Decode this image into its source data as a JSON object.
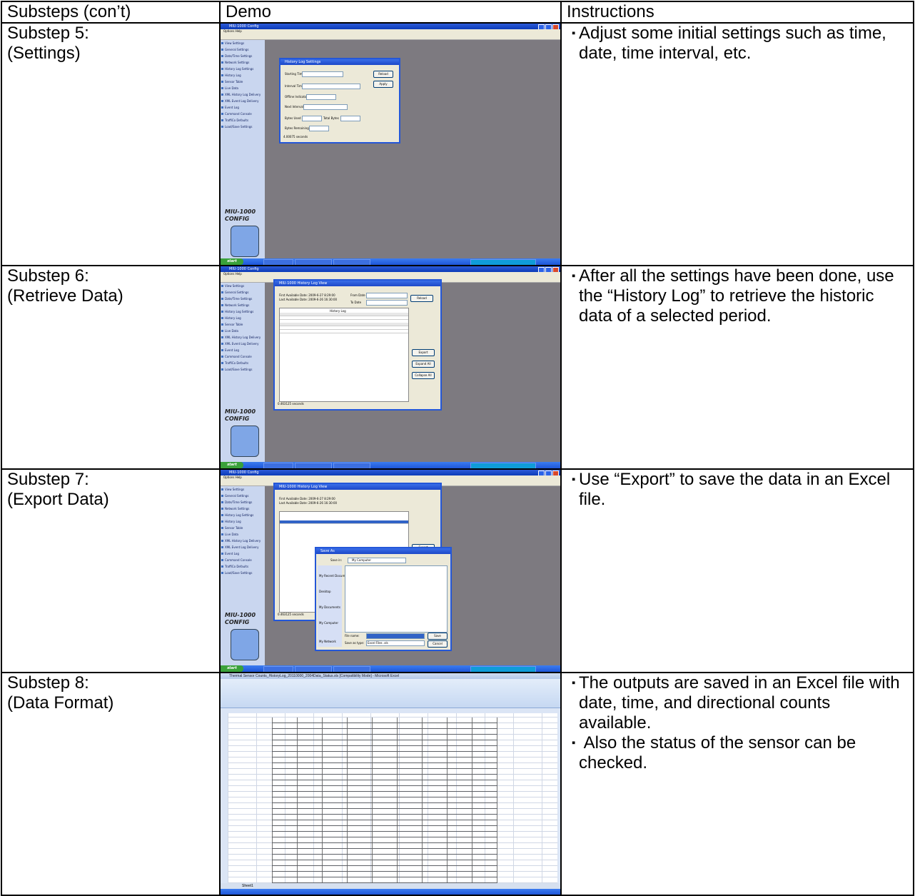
{
  "headers": {
    "substeps": "Substeps (con’t)",
    "demo": "Demo",
    "instructions": "Instructions"
  },
  "rows": [
    {
      "substep": "Substep 5:",
      "subtitle": "(Settings)",
      "instructions": [
        "Adjust some initial settings such as time, date, time interval, etc."
      ]
    },
    {
      "substep": "Substep 6:",
      "subtitle": "(Retrieve Data)",
      "instructions": [
        "After all the settings have been done, use the “History Log” to retrieve the historic data of a selected period."
      ]
    },
    {
      "substep": "Substep 7:",
      "subtitle": "(Export Data)",
      "instructions": [
        "Use “Export” to save the data in an Excel file."
      ]
    },
    {
      "substep": "Substep 8:",
      "subtitle": "(Data Format)",
      "instructions": [
        "The outputs are saved in an Excel file with date, time, and directional counts available.",
        " Also the status of the sensor can be checked."
      ]
    }
  ],
  "bullet_glyph": "▪",
  "miu_app": {
    "title": "MIU-1000 Config",
    "menu": "Options   Help",
    "logo_line1": "MIU-1000",
    "logo_line2": "CONFIG",
    "sidebar": [
      "View Settings",
      "General Settings",
      "Date/Time Settings",
      "Network Settings",
      "History Log Settings",
      "History Log",
      "Sensor Table",
      "Live Data",
      "XML History Log Delivery",
      "XML Event Log Delivery",
      "Event Log",
      "Command Console",
      "TraffiCo Defaults",
      "Load/Save Settings"
    ],
    "start": "start"
  },
  "settings_dialog": {
    "title": "History Log Settings",
    "starting_time_label": "Starting Time",
    "interval_label": "Interval Time",
    "offline_label": "Offline Indicator",
    "next_label": "Next Interval",
    "bytes_used_label": "Bytes Used",
    "total_bytes_label": "Total Bytes",
    "bytes_remaining_label": "Bytes Remaining",
    "reload": "Reload",
    "apply": "Apply",
    "status": "4.00075 seconds"
  },
  "history_view": {
    "title": "MIU-1000 History Log View",
    "first_available": "First Available Date: 2009-6-27 8:29:00",
    "last_available": "Last Available Date: 2009-6-26 16:30:00",
    "from_label": "From Date",
    "to_label": "To Date",
    "reload": "Reload",
    "export": "Export",
    "expand": "Expand All",
    "collapse": "Collapse All",
    "grid_title": "History Log",
    "status": "0.463125 seconds"
  },
  "save_dialog": {
    "title": "Save As",
    "save_in_label": "Save in:",
    "save_in_value": "My Computer",
    "file_name_label": "File name:",
    "save_type_label": "Save as type:",
    "save_type_value": "Excel Files .xls",
    "save": "Save",
    "cancel": "Cancel",
    "places": [
      "My Recent Documents",
      "Desktop",
      "My Documents",
      "My Computer",
      "My Network"
    ]
  },
  "excel": {
    "title": "Thermal Sensor Counts_HistoryLog_20110000_2004Data_Status.xls [Compatibility Mode] - Microsoft Excel",
    "tab": "Sheet1"
  }
}
